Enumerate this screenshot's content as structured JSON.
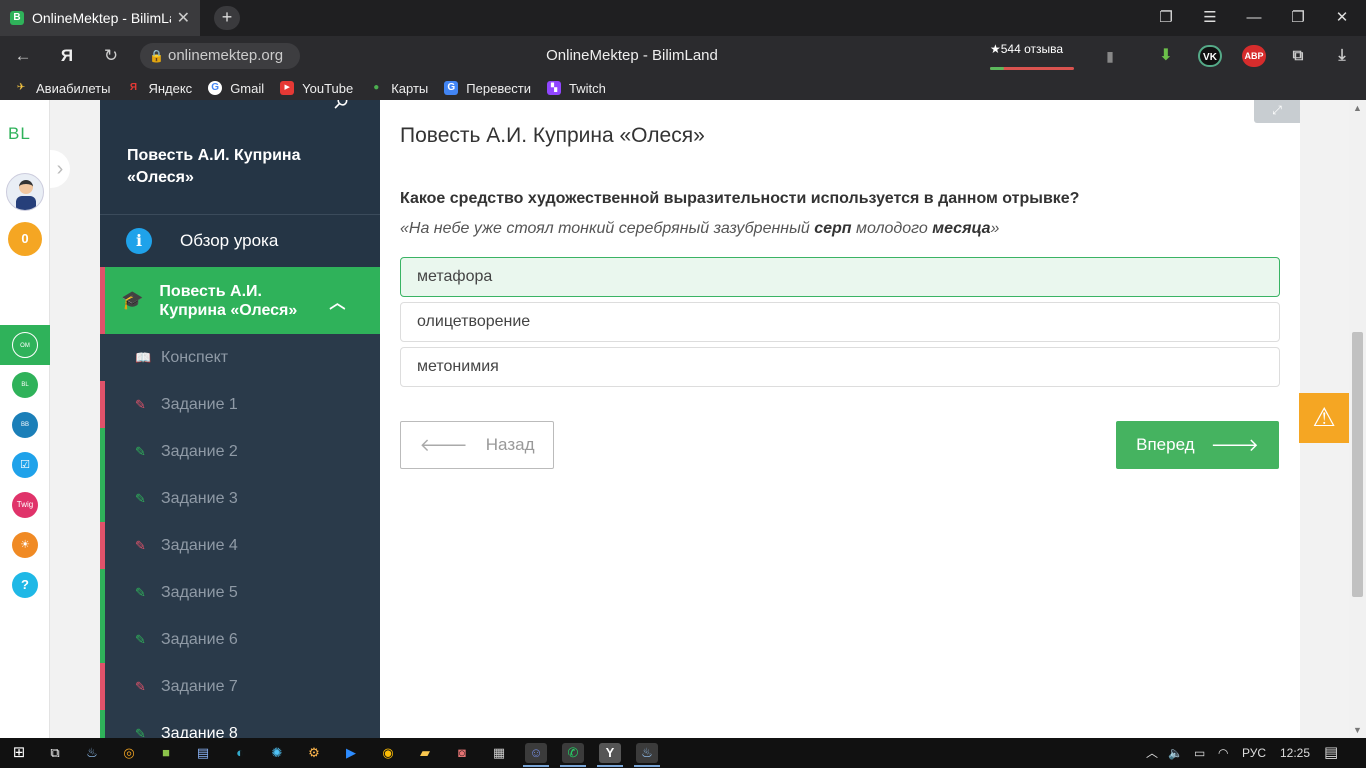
{
  "browser": {
    "tab_title": "OnlineMektep - BilimLand",
    "tab_favicon": "B",
    "new_tab": "+",
    "url": "onlinemektep.org",
    "page_title": "OnlineMektep - BilimLand",
    "reviews": "★544 отзыва",
    "ext_abp": "ABP",
    "bookmarks": [
      "Авиабилеты",
      "Яндекс",
      "Gmail",
      "YouTube",
      "Карты",
      "Перевести",
      "Twitch"
    ]
  },
  "appbar": {
    "logo": "BL",
    "coins": "0",
    "help": "?",
    "services": [
      {
        "name": "Online Mektep",
        "color": "#2fb25a"
      },
      {
        "name": "Bilim Land",
        "color": "#2fb25a"
      },
      {
        "name": "Bilim Book",
        "color": "#1b7fb8"
      },
      {
        "name": "Bilimtest",
        "color": "#1fa2ea"
      },
      {
        "name": "Twig",
        "color": "#e0336a"
      },
      {
        "name": "Imektep",
        "color": "#f08a24"
      }
    ]
  },
  "sidebar": {
    "lesson_title": "Повесть А.И. Куприна «Олеся»",
    "overview_label": "Обзор урока",
    "current_label": "Повесть А.И. Куприна «Олеся»",
    "items": [
      {
        "label": "Конспект",
        "status": "none"
      },
      {
        "label": "Задание 1",
        "status": "bad"
      },
      {
        "label": "Задание 2",
        "status": "ok"
      },
      {
        "label": "Задание 3",
        "status": "ok"
      },
      {
        "label": "Задание 4",
        "status": "bad"
      },
      {
        "label": "Задание 5",
        "status": "ok"
      },
      {
        "label": "Задание 6",
        "status": "ok"
      },
      {
        "label": "Задание 7",
        "status": "bad"
      },
      {
        "label": "Задание 8",
        "status": "ok"
      }
    ]
  },
  "main": {
    "heading": "Повесть А.И. Куприна «Олеся»",
    "question": "Какое средство художественной выразительности используется в данном отрывке?",
    "quote_parts": [
      "«На небе уже стоял тонкий серебряный зазубренный ",
      "серп",
      " молодого ",
      "месяца",
      "»"
    ],
    "options": [
      {
        "label": "метафора",
        "selected": true
      },
      {
        "label": "олицетворение",
        "selected": false
      },
      {
        "label": "метонимия",
        "selected": false
      }
    ],
    "back_label": "Назад",
    "next_label": "Вперед"
  },
  "taskbar": {
    "lang": "РУС",
    "time": "12:25"
  }
}
